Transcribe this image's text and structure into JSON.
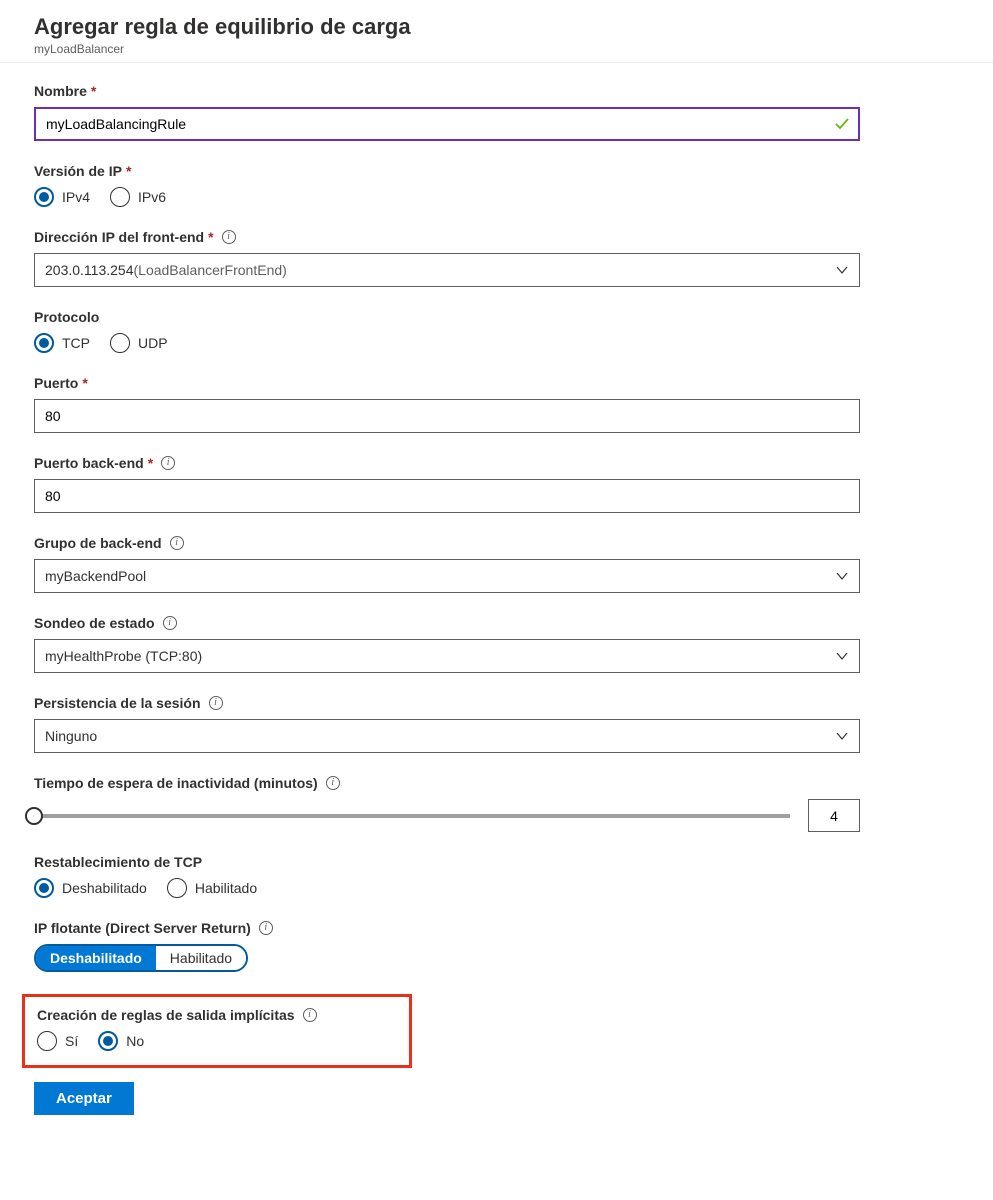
{
  "header": {
    "title": "Agregar regla de equilibrio de carga",
    "subtitle": "myLoadBalancer"
  },
  "fields": {
    "name": {
      "label": "Nombre",
      "value": "myLoadBalancingRule"
    },
    "ipVersion": {
      "label": "Versión de IP",
      "opt1": "IPv4",
      "opt2": "IPv6"
    },
    "frontendIp": {
      "label": "Dirección IP del front-end",
      "value": "203.0.113.254",
      "hint": "(LoadBalancerFrontEnd)"
    },
    "protocol": {
      "label": "Protocolo",
      "opt1": "TCP",
      "opt2": "UDP"
    },
    "port": {
      "label": "Puerto",
      "value": "80"
    },
    "backendPort": {
      "label": "Puerto back-end",
      "value": "80"
    },
    "backendGroup": {
      "label": "Grupo de back-end",
      "value": "myBackendPool"
    },
    "healthProbe": {
      "label": "Sondeo de estado",
      "value": "myHealthProbe (TCP:80)"
    },
    "persistence": {
      "label": "Persistencia de la sesión",
      "value": "Ninguno"
    },
    "idleTimeout": {
      "label": "Tiempo de espera de inactividad (minutos)",
      "value": "4"
    },
    "tcpReset": {
      "label": "Restablecimiento de TCP",
      "opt1": "Deshabilitado",
      "opt2": "Habilitado"
    },
    "floatingIp": {
      "label": "IP flotante (Direct Server Return)",
      "opt1": "Deshabilitado",
      "opt2": "Habilitado"
    },
    "outboundRules": {
      "label": "Creación de reglas de salida implícitas",
      "opt1": "Sí",
      "opt2": "No"
    }
  },
  "actions": {
    "accept": "Aceptar"
  },
  "required": "*"
}
